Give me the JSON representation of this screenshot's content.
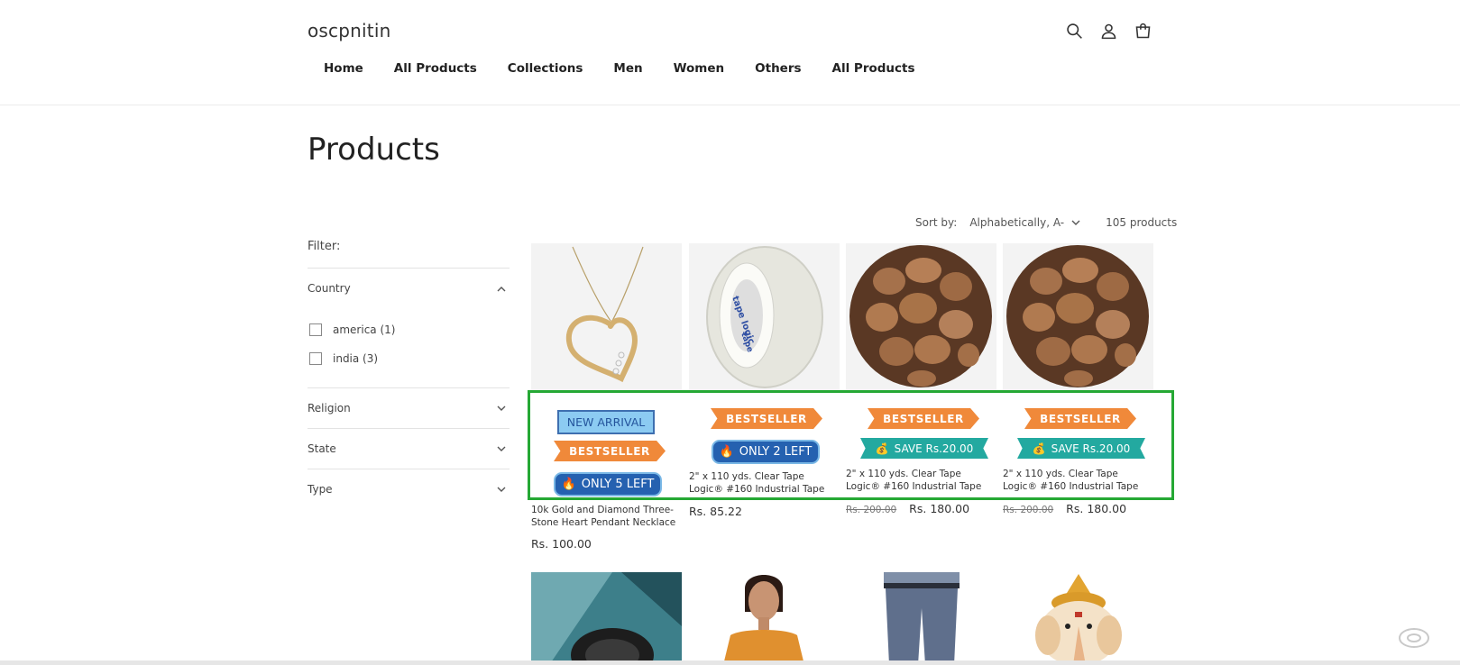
{
  "header": {
    "brand": "oscpnitin",
    "nav": [
      "Home",
      "All Products",
      "Collections",
      "Men",
      "Women",
      "Others",
      "All Products"
    ],
    "icons": [
      "search-icon",
      "account-icon",
      "cart-icon"
    ]
  },
  "page": {
    "title": "Products"
  },
  "sort": {
    "label": "Sort by:",
    "selected": "Alphabetically, A-",
    "count": "105 products"
  },
  "filters": {
    "title": "Filter:",
    "groups": [
      {
        "name": "Country",
        "expanded": true,
        "options": [
          {
            "label": "america (1)"
          },
          {
            "label": "india (3)"
          }
        ]
      },
      {
        "name": "Religion",
        "expanded": false
      },
      {
        "name": "State",
        "expanded": false
      },
      {
        "name": "Type",
        "expanded": false
      }
    ]
  },
  "badges": {
    "new_arrival": "NEW ARRIVAL",
    "bestseller": "BESTSELLER",
    "only5": "ONLY 5 LEFT",
    "only2": "ONLY 2 LEFT",
    "save": "SAVE Rs.20.00"
  },
  "products": [
    {
      "title": "10k Gold and Diamond Three-Stone Heart Pendant Necklace",
      "price": "Rs. 100.00"
    },
    {
      "title": "2\" x 110 yds. Clear Tape Logic® #160 Industrial Tape",
      "price": "Rs. 85.22"
    },
    {
      "title": "2\" x 110 yds. Clear Tape Logic® #160 Industrial Tape",
      "old_price": "Rs. 200.00",
      "price": "Rs. 180.00"
    },
    {
      "title": "2\" x 110 yds. Clear Tape Logic® #160 Industrial Tape",
      "old_price": "Rs. 200.00",
      "price": "Rs. 180.00"
    }
  ],
  "colors": {
    "accent_border": "#25a834",
    "bestseller": "#f0893a",
    "save": "#23a9a0",
    "stock": "#2561b0",
    "new_arrival": "#8ccbf2"
  }
}
